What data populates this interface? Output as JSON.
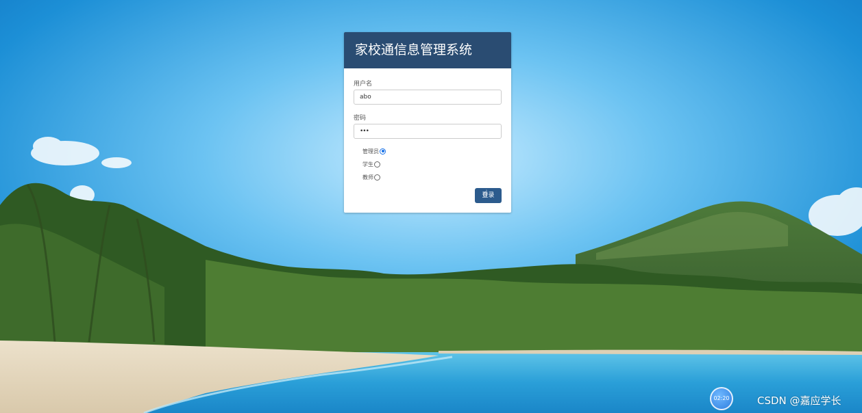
{
  "app": {
    "title": "家校通信息管理系统"
  },
  "form": {
    "username_label": "用户名",
    "username_value": "abo",
    "password_label": "密码",
    "password_value": "•••",
    "roles": [
      {
        "label": "管理员",
        "selected": true
      },
      {
        "label": "学生",
        "selected": false
      },
      {
        "label": "教师",
        "selected": false
      }
    ],
    "submit_label": "登录"
  },
  "overlay": {
    "timer": "02:20",
    "watermark": "CSDN @嘉应学长"
  },
  "colors": {
    "header_bg": "#2a4c72",
    "button_bg": "#2c5b8d",
    "sky": "#1c8fd6"
  }
}
